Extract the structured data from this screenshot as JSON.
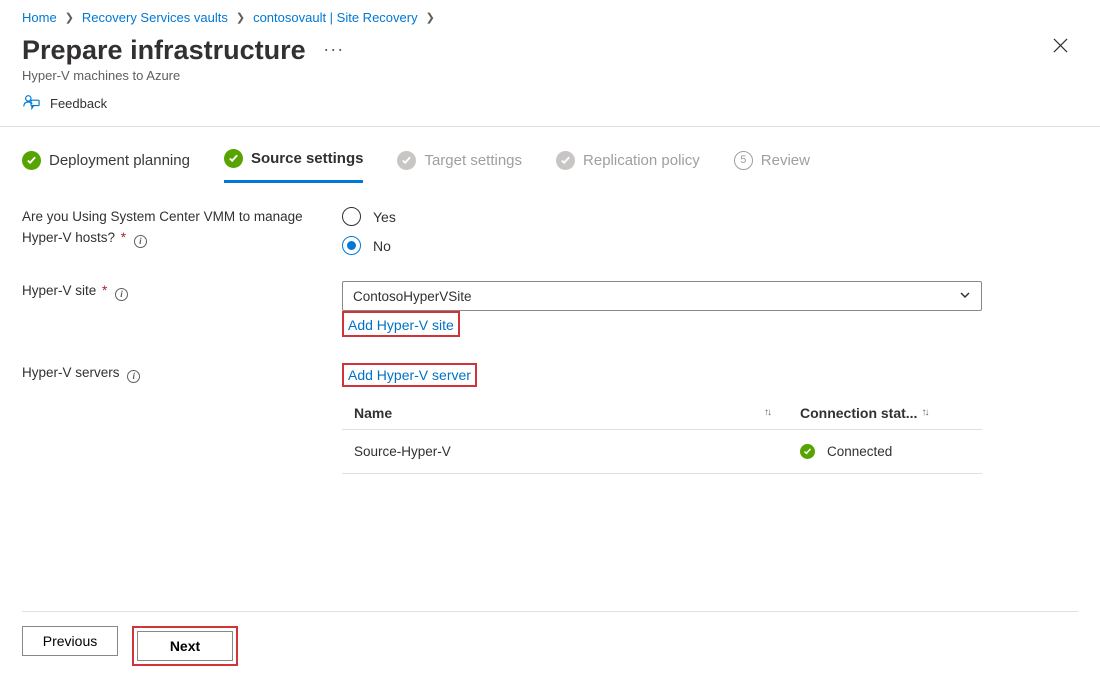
{
  "breadcrumb": [
    {
      "label": "Home"
    },
    {
      "label": "Recovery Services vaults"
    },
    {
      "label": "contosovault | Site Recovery"
    }
  ],
  "header": {
    "title": "Prepare infrastructure",
    "subtitle": "Hyper-V machines to Azure",
    "more": "···"
  },
  "feedback": {
    "label": "Feedback"
  },
  "steps": [
    {
      "label": "Deployment planning",
      "state": "done"
    },
    {
      "label": "Source settings",
      "state": "active"
    },
    {
      "label": "Target settings",
      "state": "disabled"
    },
    {
      "label": "Replication policy",
      "state": "disabled"
    },
    {
      "label": "Review",
      "state": "number",
      "num": "5"
    }
  ],
  "form": {
    "vmm_question": "Are you Using System Center VMM to manage Hyper-V hosts?",
    "yes": "Yes",
    "no": "No",
    "vmm_selected": "no",
    "site_label": "Hyper-V site",
    "site_value": "ContosoHyperVSite",
    "add_site_link": "Add Hyper-V site",
    "servers_label": "Hyper-V servers",
    "add_server_link": "Add Hyper-V server",
    "table": {
      "col_name": "Name",
      "col_status": "Connection stat...",
      "rows": [
        {
          "name": "Source-Hyper-V",
          "status": "Connected"
        }
      ]
    }
  },
  "footer": {
    "previous": "Previous",
    "next": "Next"
  },
  "info_char": "i"
}
